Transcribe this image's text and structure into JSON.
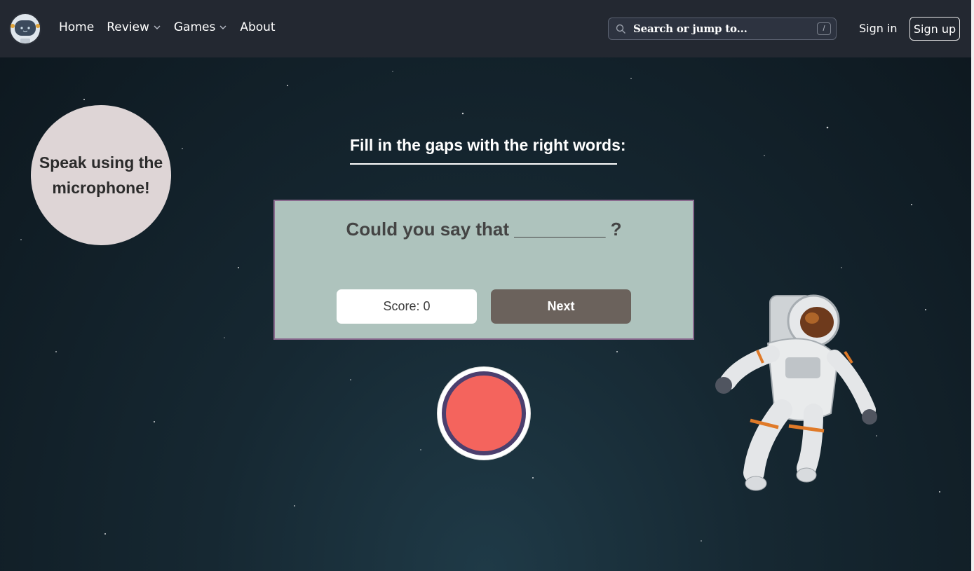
{
  "navbar": {
    "logo_icon": "astronaut-logo-icon",
    "links": [
      {
        "label": "Home",
        "dropdown": false
      },
      {
        "label": "Review",
        "dropdown": true
      },
      {
        "label": "Games",
        "dropdown": true
      },
      {
        "label": "About",
        "dropdown": false
      }
    ],
    "search": {
      "placeholder": "Search or jump to...",
      "shortcut": "/",
      "icon": "search-icon"
    },
    "sign_in": "Sign in",
    "sign_up": "Sign up"
  },
  "hint": {
    "text": "Speak using the microphone!"
  },
  "game": {
    "instruction": "Fill in the gaps with the right words:",
    "question": "Could you say that _________ ?",
    "score_label": "Score: 0",
    "next_label": "Next"
  },
  "record_button": {
    "icon": "record-icon",
    "color": "#f4645d",
    "ring_color": "#4c3f6e"
  },
  "colors": {
    "navbar_bg": "#232831",
    "card_bg": "#aec3bd",
    "card_border": "#8a6a8f",
    "hint_bg": "#ded5d6",
    "next_bg": "#6b625c"
  }
}
